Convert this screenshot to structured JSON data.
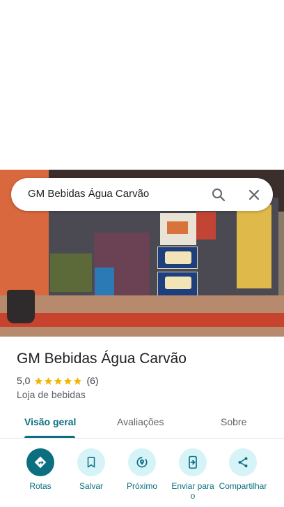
{
  "search": {
    "query": "GM Bebidas Água Carvão",
    "icons": [
      "search-icon",
      "close-icon"
    ]
  },
  "place": {
    "name": "GM Bebidas Água Carvão",
    "rating": "5,0",
    "review_count": "(6)",
    "stars": 5,
    "category": "Loja de bebidas"
  },
  "tabs": [
    {
      "label": "Visão geral",
      "selected": true
    },
    {
      "label": "Avaliações",
      "selected": false
    },
    {
      "label": "Sobre",
      "selected": false
    }
  ],
  "actions": [
    {
      "label": "Rotas",
      "icon": "directions-icon"
    },
    {
      "label": "Salvar",
      "icon": "bookmark-icon"
    },
    {
      "label": "Próximo",
      "icon": "nearby-icon"
    },
    {
      "label": "Enviar para o",
      "icon": "send-to-phone-icon"
    },
    {
      "label": "Compartilhar",
      "icon": "share-icon"
    }
  ],
  "colors": {
    "accent": "#0b6f80",
    "accent_light": "#d6f3f8",
    "star": "#f4b400",
    "text": "#202124",
    "muted": "#5f6368"
  }
}
